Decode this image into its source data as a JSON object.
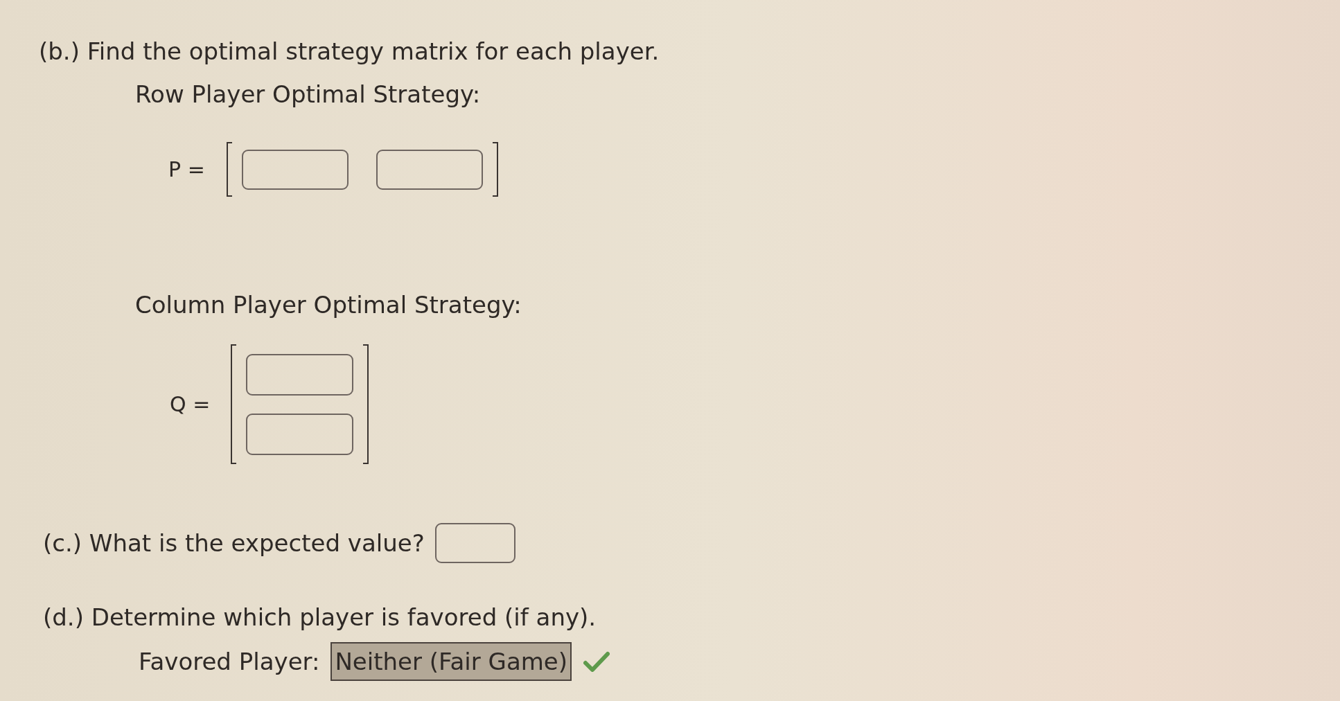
{
  "part_b": {
    "heading": "(b.) Find the optimal strategy matrix for each player.",
    "row_player": {
      "label": "Row Player Optimal Strategy:",
      "symbol": "P =",
      "kind": "row",
      "fields": [
        {
          "kind": "blank"
        },
        {
          "kind": "blank"
        }
      ]
    },
    "column_player": {
      "label": "Column Player Optimal Strategy:",
      "symbol": "Q =",
      "kind": "column",
      "fields": [
        {
          "kind": "blank"
        },
        {
          "kind": "blank"
        }
      ]
    }
  },
  "part_c": {
    "question": "(c.) What is the expected value?",
    "answer": {
      "kind": "blank"
    }
  },
  "part_d": {
    "question": "(d.) Determine which player is favored (if any).",
    "label": "Favored Player:",
    "answer": {
      "value": "Neither (Fair Game)",
      "correct": true
    }
  }
}
